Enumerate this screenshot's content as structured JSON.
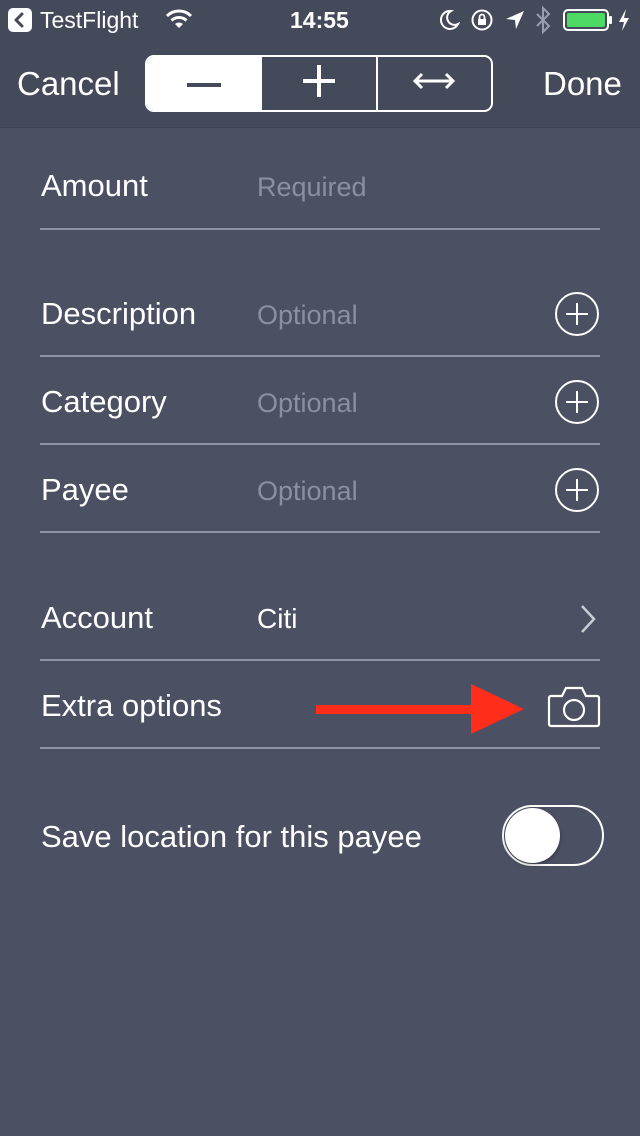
{
  "status_bar": {
    "back_app": "TestFlight",
    "time": "14:55",
    "battery_color": "#4cd964"
  },
  "nav": {
    "cancel_label": "Cancel",
    "done_label": "Done",
    "segments": [
      {
        "icon": "minus-icon",
        "selected": true
      },
      {
        "icon": "plus-icon",
        "selected": false
      },
      {
        "icon": "transfer-arrows-icon",
        "selected": false
      }
    ]
  },
  "form": {
    "amount": {
      "label": "Amount",
      "placeholder": "Required"
    },
    "description": {
      "label": "Description",
      "placeholder": "Optional"
    },
    "category": {
      "label": "Category",
      "placeholder": "Optional"
    },
    "payee": {
      "label": "Payee",
      "placeholder": "Optional"
    },
    "account": {
      "label": "Account",
      "value": "Citi"
    },
    "extra": {
      "label": "Extra options"
    },
    "save_location": {
      "label": "Save location for this payee",
      "enabled": false
    }
  },
  "annotation": {
    "arrow_color": "#ff2d1a"
  }
}
